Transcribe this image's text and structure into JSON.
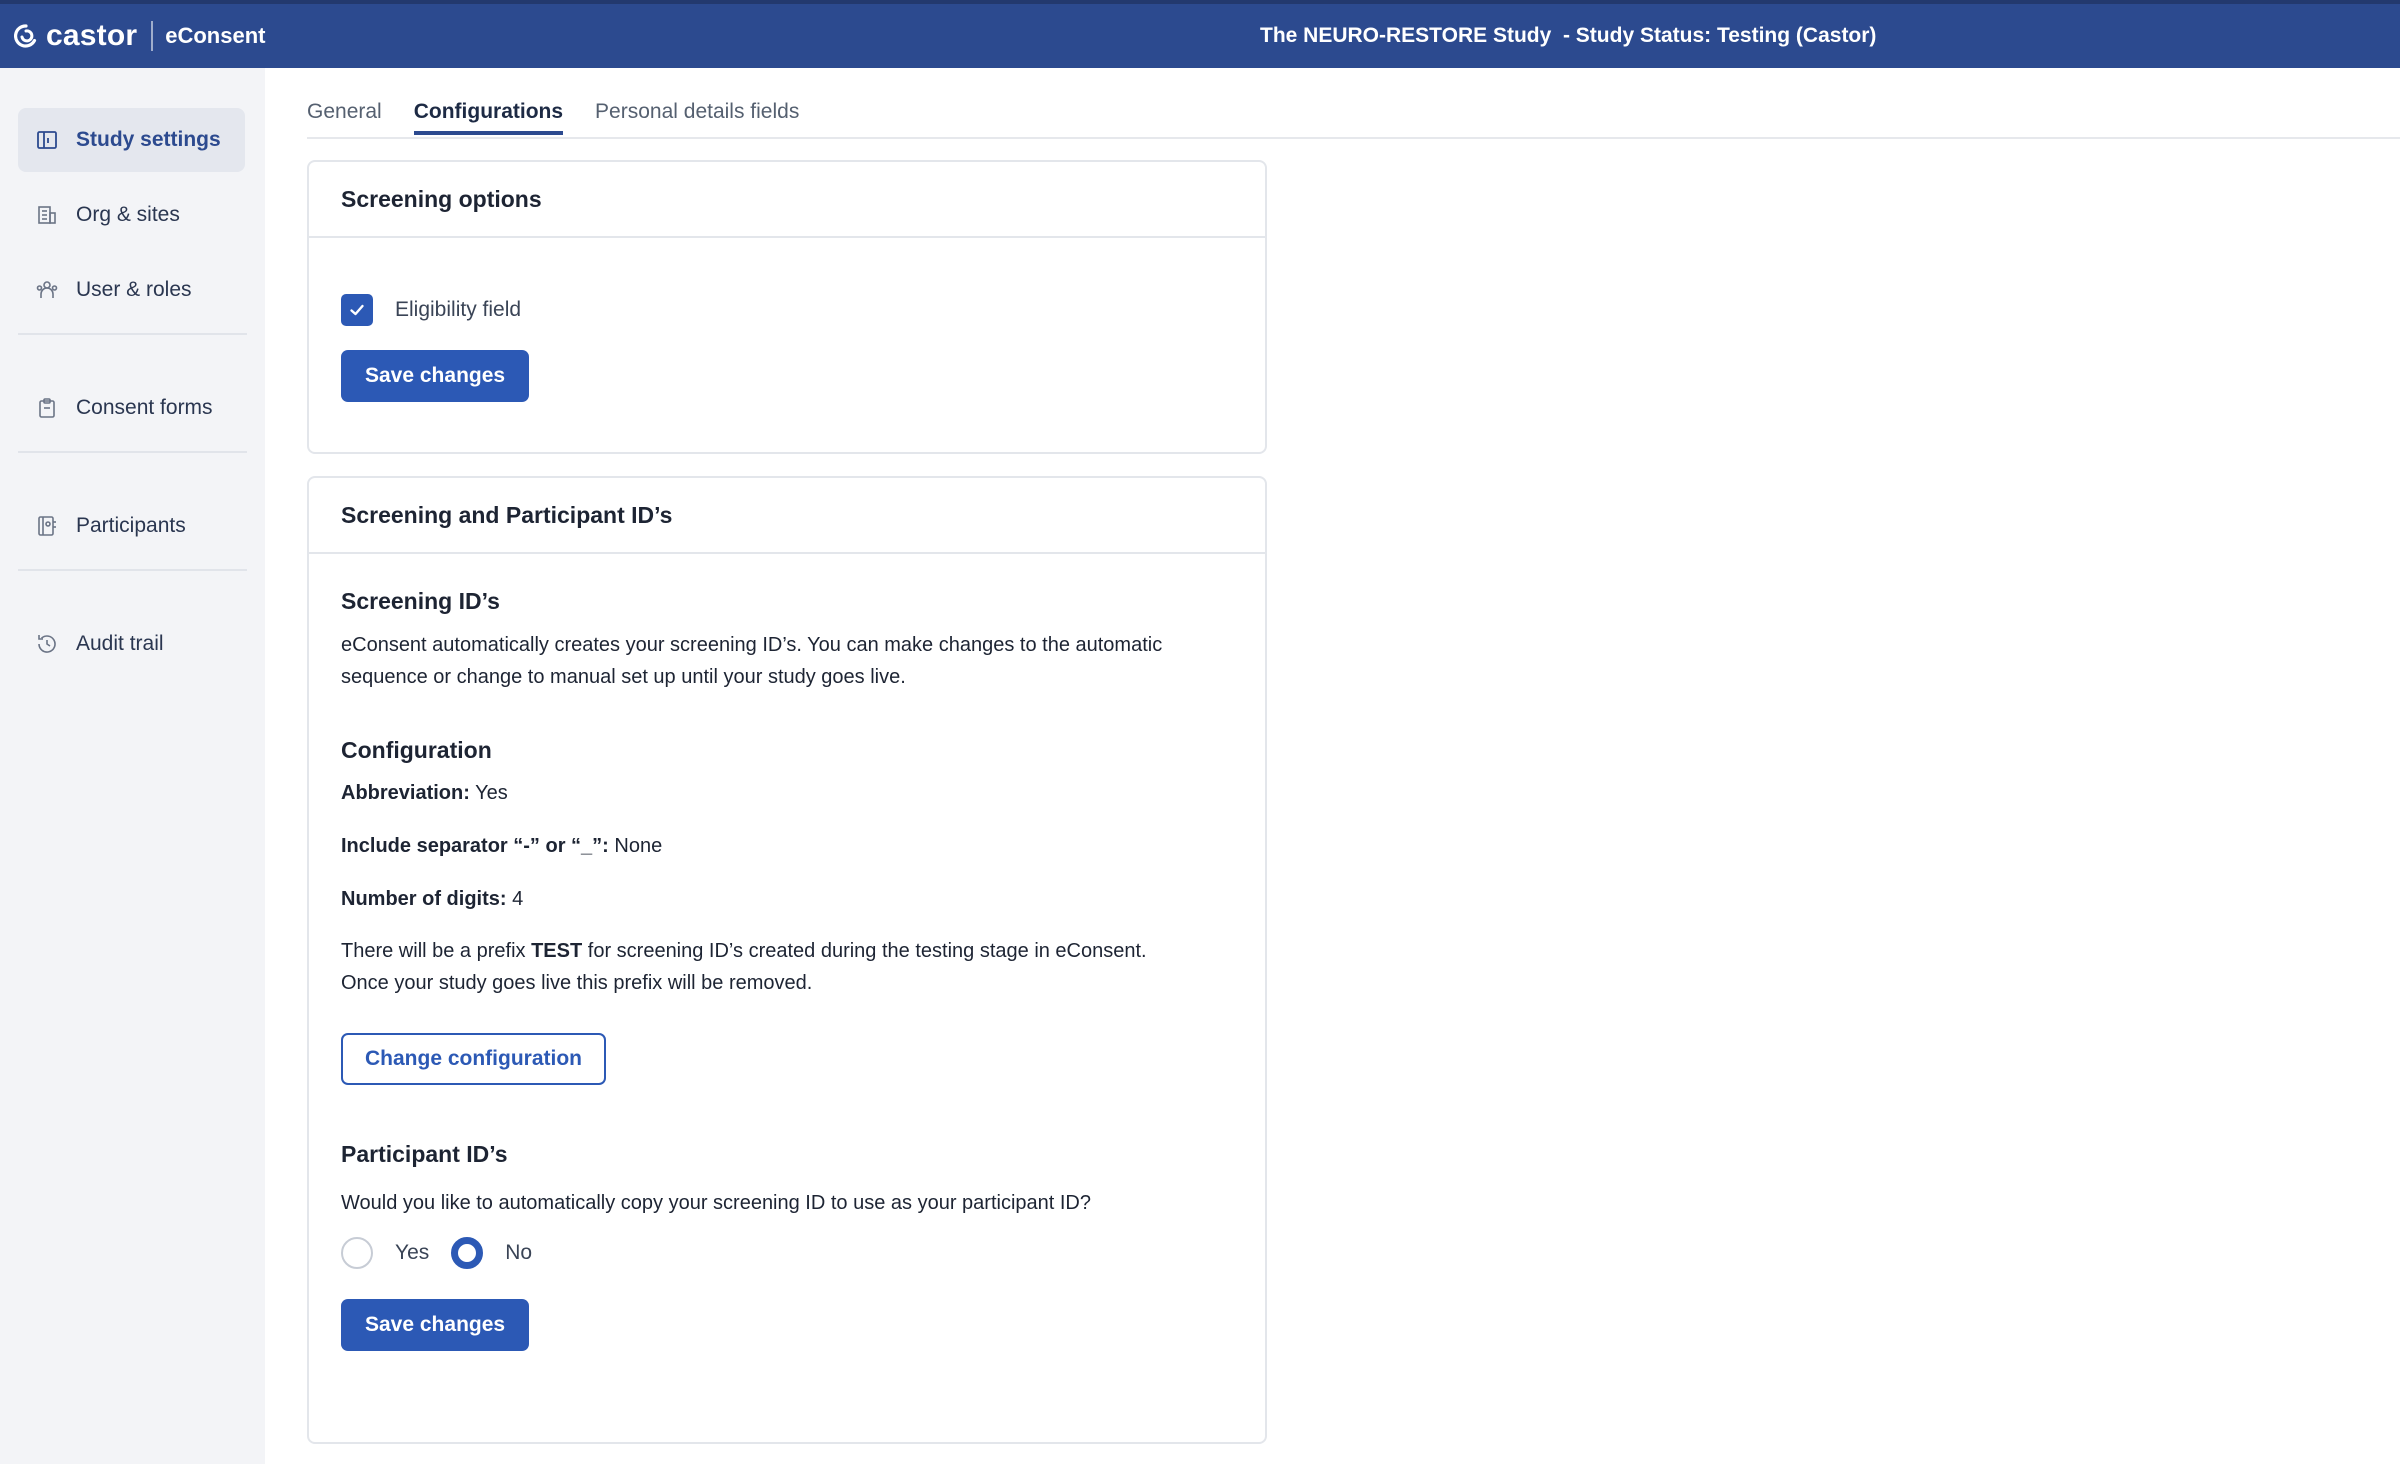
{
  "header": {
    "brand_name": "castor",
    "product": "eConsent",
    "study_title": "The NEURO-RESTORE Study  - Study Status: Testing (Castor)"
  },
  "sidebar": {
    "items": [
      {
        "label": "Study settings",
        "icon": "study-settings-icon",
        "active": true
      },
      {
        "label": "Org & sites",
        "icon": "building-icon"
      },
      {
        "label": "User & roles",
        "icon": "users-icon"
      },
      {
        "label": "Consent forms",
        "icon": "clipboard-icon"
      },
      {
        "label": "Participants",
        "icon": "participants-icon"
      },
      {
        "label": "Audit trail",
        "icon": "history-icon"
      }
    ]
  },
  "tabs": [
    {
      "label": "General"
    },
    {
      "label": "Configurations",
      "active": true
    },
    {
      "label": "Personal details fields"
    }
  ],
  "screening_options": {
    "title": "Screening options",
    "eligibility_label": "Eligibility field",
    "eligibility_checked": true,
    "save_label": "Save changes"
  },
  "screening_ids": {
    "title": "Screening and Participant ID’s",
    "screening_heading": "Screening ID’s",
    "description_line1": "eConsent automatically creates your screening ID’s. You can make changes to the automatic",
    "description_line2": "sequence or change to manual set up until your study goes live.",
    "configuration_heading": "Configuration",
    "abbreviation_label": "Abbreviation:",
    "abbreviation_value": "Yes",
    "separator_label": "Include separator “-” or “_”:",
    "separator_value": "None",
    "digits_label": "Number of digits:",
    "digits_value": "4",
    "prefix_text_before": "There will be a prefix ",
    "prefix_value": "TEST",
    "prefix_text_after": " for screening ID’s created during the testing stage in eConsent.",
    "prefix_line2": "Once your study goes live this prefix will be removed.",
    "change_config_label": "Change configuration",
    "participant_heading": "Participant ID’s",
    "participant_question": "Would you like to automatically copy your screening ID to use as your participant ID?",
    "option_yes": "Yes",
    "option_no": "No",
    "selected_option": "No",
    "save_label": "Save changes"
  },
  "colors": {
    "header_bg": "#2c4a8f",
    "accent": "#2c59b5",
    "sidebar_bg": "#f3f4f7"
  }
}
